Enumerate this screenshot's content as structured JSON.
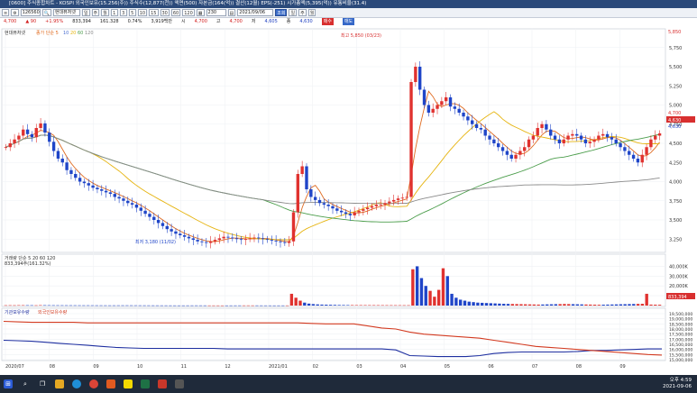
{
  "window_title": "[0600] 주식종합차트 - KOSPI 외국인보유(15.256(주)) 주식수(12,877(천)) 액면(500) 자본금(164(억)) 결산(12월) EPS(-251) 시가총액(5,395(억)) 유통비율(31.4)",
  "toolbar": {
    "code": "126560",
    "name": "현대퓨처넷",
    "periods": [
      "일",
      "주",
      "월",
      "1",
      "3",
      "5",
      "10",
      "15",
      "30",
      "60",
      "120"
    ],
    "count": "230",
    "date": "2021/09/06",
    "check_label": "조회",
    "options": [
      "일",
      "주",
      "월"
    ]
  },
  "info": {
    "price": "4,700",
    "change": "▲ 90",
    "change_pct": "+1.95%",
    "volume": "833,394",
    "trade_amt": "161.328",
    "ratio": "0.74%",
    "value": "3,919백만",
    "label_open": "시",
    "label_high": "고",
    "label_low": "저",
    "open": "4,700",
    "high": "4,700",
    "low": "4,605",
    "close_label": "종",
    "close": "4,630",
    "buy": "매수",
    "sell": "매도"
  },
  "chart_data": {
    "type": "candlestick",
    "price_panel": {
      "legend": "현대퓨처넷",
      "ma_legend": [
        "종가 단순 5",
        "10",
        "20",
        "60",
        "120"
      ],
      "yticks": [
        "5,750",
        "5,500",
        "5,250",
        "5,000",
        "4,750",
        "4,500",
        "4,250",
        "4,000",
        "3,750",
        "3,500",
        "3,250"
      ],
      "ylim": [
        3100,
        5900
      ],
      "annotation_high": "최고 5,850 (03/23)",
      "annotation_low": "최저 3,180 (11/02)",
      "current_price": "4,630",
      "max_label": "5,850",
      "side_labels": [
        "4,700",
        "4,630"
      ],
      "close_series": [
        4450,
        4500,
        4550,
        4600,
        4680,
        4620,
        4580,
        4700,
        4760,
        4640,
        4520,
        4400,
        4300,
        4250,
        4150,
        4100,
        4050,
        4000,
        3980,
        3950,
        3920,
        3900,
        3880,
        3860,
        3840,
        3800,
        3780,
        3750,
        3720,
        3700,
        3660,
        3620,
        3580,
        3540,
        3500,
        3460,
        3420,
        3380,
        3350,
        3320,
        3300,
        3280,
        3260,
        3240,
        3220,
        3210,
        3200,
        3220,
        3240,
        3260,
        3280,
        3270,
        3260,
        3250,
        3240,
        3250,
        3260,
        3270,
        3260,
        3250,
        3240,
        3230,
        3220,
        3210,
        3200,
        3220,
        3600,
        4100,
        4200,
        3900,
        3800,
        3760,
        3720,
        3700,
        3680,
        3650,
        3620,
        3600,
        3580,
        3560,
        3600,
        3620,
        3640,
        3660,
        3680,
        3700,
        3700,
        3720,
        3740,
        3760,
        3780,
        3790,
        3800,
        5300,
        5500,
        5200,
        5000,
        4900,
        4950,
        5000,
        5050,
        5100,
        4980,
        4950,
        4900,
        4850,
        4800,
        4750,
        4700,
        4680,
        4600,
        4550,
        4500,
        4450,
        4400,
        4350,
        4300,
        4350,
        4400,
        4450,
        4550,
        4600,
        4700,
        4750,
        4680,
        4600,
        4550,
        4500,
        4550,
        4600,
        4620,
        4600,
        4550,
        4500,
        4520,
        4550,
        4600,
        4620,
        4580,
        4550,
        4500,
        4450,
        4400,
        4350,
        4300,
        4250,
        4350,
        4450,
        4550,
        4600,
        4630
      ]
    },
    "volume_panel": {
      "legend": "거래량 단순 5 20 60 120",
      "value_label": "833,394주(161.32%)",
      "yticks": [
        "40,000K",
        "30,000K",
        "20,000K",
        "10,000K"
      ],
      "current_label": "833,394",
      "ylim": [
        0,
        45000
      ],
      "values": [
        300,
        350,
        320,
        400,
        380,
        360,
        340,
        300,
        420,
        380,
        350,
        330,
        310,
        300,
        290,
        280,
        270,
        260,
        250,
        260,
        240,
        230,
        220,
        210,
        200,
        210,
        220,
        230,
        240,
        230,
        220,
        210,
        200,
        190,
        180,
        170,
        160,
        150,
        140,
        130,
        120,
        130,
        140,
        150,
        160,
        150,
        140,
        130,
        120,
        110,
        100,
        110,
        120,
        130,
        140,
        150,
        160,
        150,
        140,
        130,
        120,
        110,
        100,
        110,
        120,
        130,
        12000,
        8000,
        5000,
        3000,
        2000,
        1500,
        1200,
        1000,
        900,
        800,
        700,
        600,
        550,
        500,
        480,
        460,
        450,
        440,
        430,
        420,
        410,
        400,
        390,
        380,
        370,
        360,
        350,
        360,
        37000,
        40000,
        28000,
        20000,
        15000,
        9000,
        16000,
        38000,
        30000,
        12000,
        8000,
        6000,
        5000,
        4000,
        3500,
        3000,
        2800,
        2600,
        2400,
        2200,
        2000,
        1800,
        1700,
        1600,
        1500,
        1400,
        1300,
        1200,
        1100,
        1000,
        1100,
        1200,
        1300,
        1400,
        1500,
        1600,
        1500,
        1400,
        1300,
        1200,
        1100,
        1000,
        900,
        800,
        900,
        1000,
        1100,
        1200,
        1300,
        1400,
        1500,
        1600,
        1700,
        1800,
        12000,
        1000,
        900,
        833
      ]
    },
    "holdings_panel": {
      "legend_series": [
        "기관보유수량",
        "외국인보유수량"
      ],
      "yticks": [
        "19,500,000",
        "19,000,000",
        "18,500,000",
        "18,000,000",
        "17,500,000",
        "17,000,000",
        "16,500,000",
        "16,000,000",
        "15,500,000",
        "15,000,000"
      ],
      "right_labels": [
        "18,550,000",
        "15,500,000"
      ],
      "ylim": [
        15000000,
        19500000
      ],
      "institutional": [
        16900000,
        16850000,
        16800000,
        16700000,
        16600000,
        16500000,
        16400000,
        16300000,
        16200000,
        16150000,
        16100000,
        16100000,
        16100000,
        16100000,
        16100000,
        16100000,
        16050000,
        16050000,
        16050000,
        16050000,
        16050000,
        16050000,
        16050000,
        16050000,
        16050000,
        16050000,
        16050000,
        16050000,
        15950000,
        15400000,
        15350000,
        15300000,
        15300000,
        15300000,
        15400000,
        15600000,
        15700000,
        15750000,
        15750000,
        15750000,
        15750000,
        15800000,
        15900000,
        15900000,
        15950000,
        16000000,
        16050000,
        16050000
      ],
      "foreign": [
        18750000,
        18700000,
        18650000,
        18650000,
        18650000,
        18650000,
        18600000,
        18600000,
        18600000,
        18600000,
        18600000,
        18600000,
        18600000,
        18600000,
        18600000,
        18600000,
        18600000,
        18600000,
        18600000,
        18600000,
        18600000,
        18600000,
        18550000,
        18500000,
        18500000,
        18500000,
        18300000,
        18100000,
        18000000,
        17700000,
        17500000,
        17400000,
        17300000,
        17200000,
        17100000,
        16900000,
        16700000,
        16500000,
        16300000,
        16200000,
        16100000,
        16000000,
        15900000,
        15800000,
        15700000,
        15600000,
        15500000,
        15450000
      ]
    },
    "xticks": [
      "2020/07",
      "08",
      "09",
      "10",
      "11",
      "12",
      "2021/01",
      "02",
      "03",
      "04",
      "05",
      "06",
      "07",
      "08",
      "09"
    ]
  },
  "taskbar": {
    "time": "오후 4:59",
    "date": "2021-09-06",
    "apps": [
      "windows-start",
      "search",
      "task-view",
      "file-explorer",
      "edge",
      "chrome",
      "hanbit",
      "kakao",
      "excel",
      "photos",
      "settings"
    ]
  },
  "colors": {
    "up": "#e0322f",
    "down": "#1f45c8",
    "ma5": "#e06b20",
    "ma20": "#e6b410",
    "ma60": "#4b9d4b",
    "ma120": "#8a8a8a",
    "inst": "#1e2fa0",
    "foreign": "#d23a20"
  }
}
